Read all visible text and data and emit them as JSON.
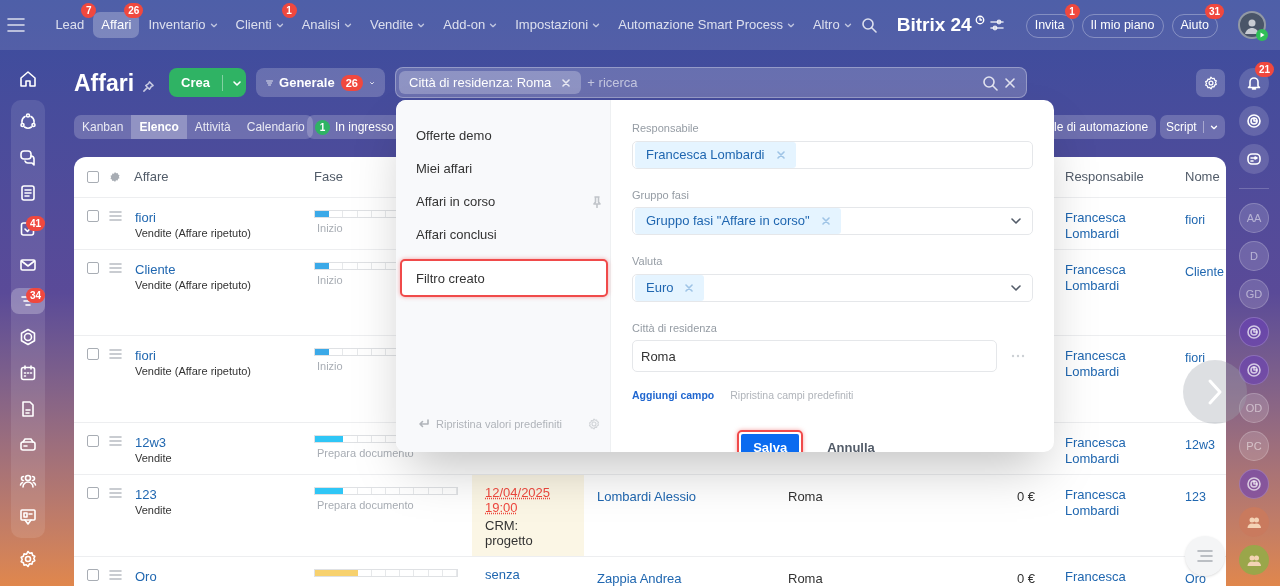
{
  "top_nav": {
    "items": [
      {
        "label": "Lead",
        "badge": "7",
        "selected": false,
        "dropdown": false
      },
      {
        "label": "Affari",
        "badge": "26",
        "selected": true,
        "dropdown": false
      },
      {
        "label": "Inventario",
        "selected": false,
        "dropdown": true
      },
      {
        "label": "Clienti",
        "badge": "1",
        "selected": false,
        "dropdown": true
      },
      {
        "label": "Analisi",
        "selected": false,
        "dropdown": true
      },
      {
        "label": "Vendite",
        "selected": false,
        "dropdown": true
      },
      {
        "label": "Add-on",
        "selected": false,
        "dropdown": true
      },
      {
        "label": "Impostazioni",
        "selected": false,
        "dropdown": true
      },
      {
        "label": "Automazione Smart Process",
        "selected": false,
        "dropdown": true
      },
      {
        "label": "Altro",
        "selected": false,
        "dropdown": true
      }
    ]
  },
  "logo": "Bitrix 24",
  "header_buttons": [
    {
      "label": "Invita",
      "badge": "1"
    },
    {
      "label": "Il mio piano"
    },
    {
      "label": "Aiuto",
      "badge": "31"
    }
  ],
  "left_sidebar": {
    "items": [
      {
        "selected": false
      },
      {
        "selected": false
      },
      {
        "selected": false
      },
      {
        "selected": false,
        "badge": "41"
      },
      {
        "selected": false
      },
      {
        "selected": true,
        "badge": "34"
      },
      {
        "selected": false
      },
      {
        "selected": false
      },
      {
        "selected": false
      },
      {
        "selected": false
      },
      {
        "selected": false
      },
      {
        "selected": false
      }
    ]
  },
  "right_sidebar": {
    "notifications_badge": "21",
    "items": [
      {
        "kind": "initials",
        "initials": "AA"
      },
      {
        "kind": "initials",
        "initials": "D"
      },
      {
        "kind": "initials",
        "initials": "GD"
      },
      {
        "kind": "copilot"
      },
      {
        "kind": "copilot"
      },
      {
        "kind": "initials",
        "initials": "OD"
      },
      {
        "kind": "initials",
        "initials": "PC"
      },
      {
        "kind": "copilot"
      },
      {
        "kind": "group",
        "color": "#c97a5e"
      },
      {
        "kind": "group",
        "color": "#9aa64a"
      }
    ]
  },
  "page": {
    "title": "Affari",
    "create_button": "Crea",
    "preset": {
      "label": "Generale",
      "badge": "26"
    },
    "filter_chip": "Città di residenza: Roma",
    "search_placeholder": "+ ricerca"
  },
  "view_tabs": [
    {
      "label": "Kanban",
      "selected": false
    },
    {
      "label": "Elenco",
      "selected": true
    },
    {
      "label": "Attività",
      "selected": false
    },
    {
      "label": "Calendario",
      "selected": false
    }
  ],
  "counter_button": {
    "count": "1",
    "label": "In ingresso"
  },
  "automation_button": "le di automazione",
  "script_button": "Script",
  "table": {
    "select_all_checked": false,
    "header": {
      "deal": "Affare",
      "stage": "Fase",
      "responsible": "Responsabile",
      "name": "Nome"
    },
    "rows": [
      {
        "checked": false,
        "title": "fiori",
        "pipeline": "Vendite (Affare ripetuto)",
        "stage": "Inizio",
        "level": 0.1,
        "color": "#3ba9e8",
        "responsible": "Francesca Lombardi",
        "name": "fiori"
      },
      {
        "checked": false,
        "title": "Cliente",
        "pipeline": "Vendite (Affare ripetuto)",
        "stage": "Inizio",
        "level": 0.1,
        "color": "#3ba9e8",
        "responsible": "Francesca Lombardi",
        "name": "Cliente"
      },
      {
        "checked": false,
        "title": "fiori",
        "pipeline": "Vendite (Affare ripetuto)",
        "stage": "Inizio",
        "level": 0.1,
        "color": "#3ba9e8",
        "responsible": "Francesca Lombardi",
        "name": "fiori"
      },
      {
        "checked": false,
        "title": "12w3",
        "pipeline": "Vendite",
        "stage": "Prepara documento",
        "level": 0.2,
        "color": "#2fc6f6",
        "responsible": "Francesca Lombardi",
        "name": "12w3"
      },
      {
        "checked": false,
        "title": "123",
        "pipeline": "Vendite",
        "stage": "Prepara documento",
        "level": 0.2,
        "color": "#2fc6f6",
        "deadline": "12/04/2025 19:00",
        "deadline_note": "CRM: progetto",
        "contact": "Lombardi Alessio",
        "city": "Roma",
        "amount": "0 €",
        "responsible": "Francesca Lombardi",
        "name": "123"
      },
      {
        "checked": false,
        "title": "Oro",
        "level": 0.3,
        "color": "#f7d16e",
        "deadline": "senza",
        "contact": "Zappia Andrea",
        "city": "Roma",
        "amount": "0 €",
        "responsible": "Francesca",
        "name": "Oro"
      }
    ]
  },
  "filter_popup": {
    "presets": [
      {
        "label": "Offerte demo",
        "pinned": false
      },
      {
        "label": "Miei affari",
        "pinned": false
      },
      {
        "label": "Affari in corso",
        "pinned": true
      },
      {
        "label": "Affari conclusi",
        "pinned": false
      }
    ],
    "new_preset_input": "Filtro creato",
    "reset_link": "Ripristina valori predefiniti",
    "fields": [
      {
        "kind": "tags",
        "label": "Responsabile",
        "tags": [
          "Francesca Lombardi"
        ],
        "dropdown": false
      },
      {
        "kind": "tags",
        "label": "Gruppo fasi",
        "tags": [
          "Gruppo fasi \"Affare in corso\""
        ],
        "dropdown": true
      },
      {
        "kind": "tags",
        "label": "Valuta",
        "tags": [
          "Euro"
        ],
        "dropdown": true
      },
      {
        "kind": "text",
        "label": "Città di residenza",
        "value": "Roma"
      }
    ],
    "add_field": "Aggiungi campo",
    "restore_fields": "Ripristina campi predefiniti",
    "save_button": "Salva",
    "cancel_button": "Annulla"
  }
}
